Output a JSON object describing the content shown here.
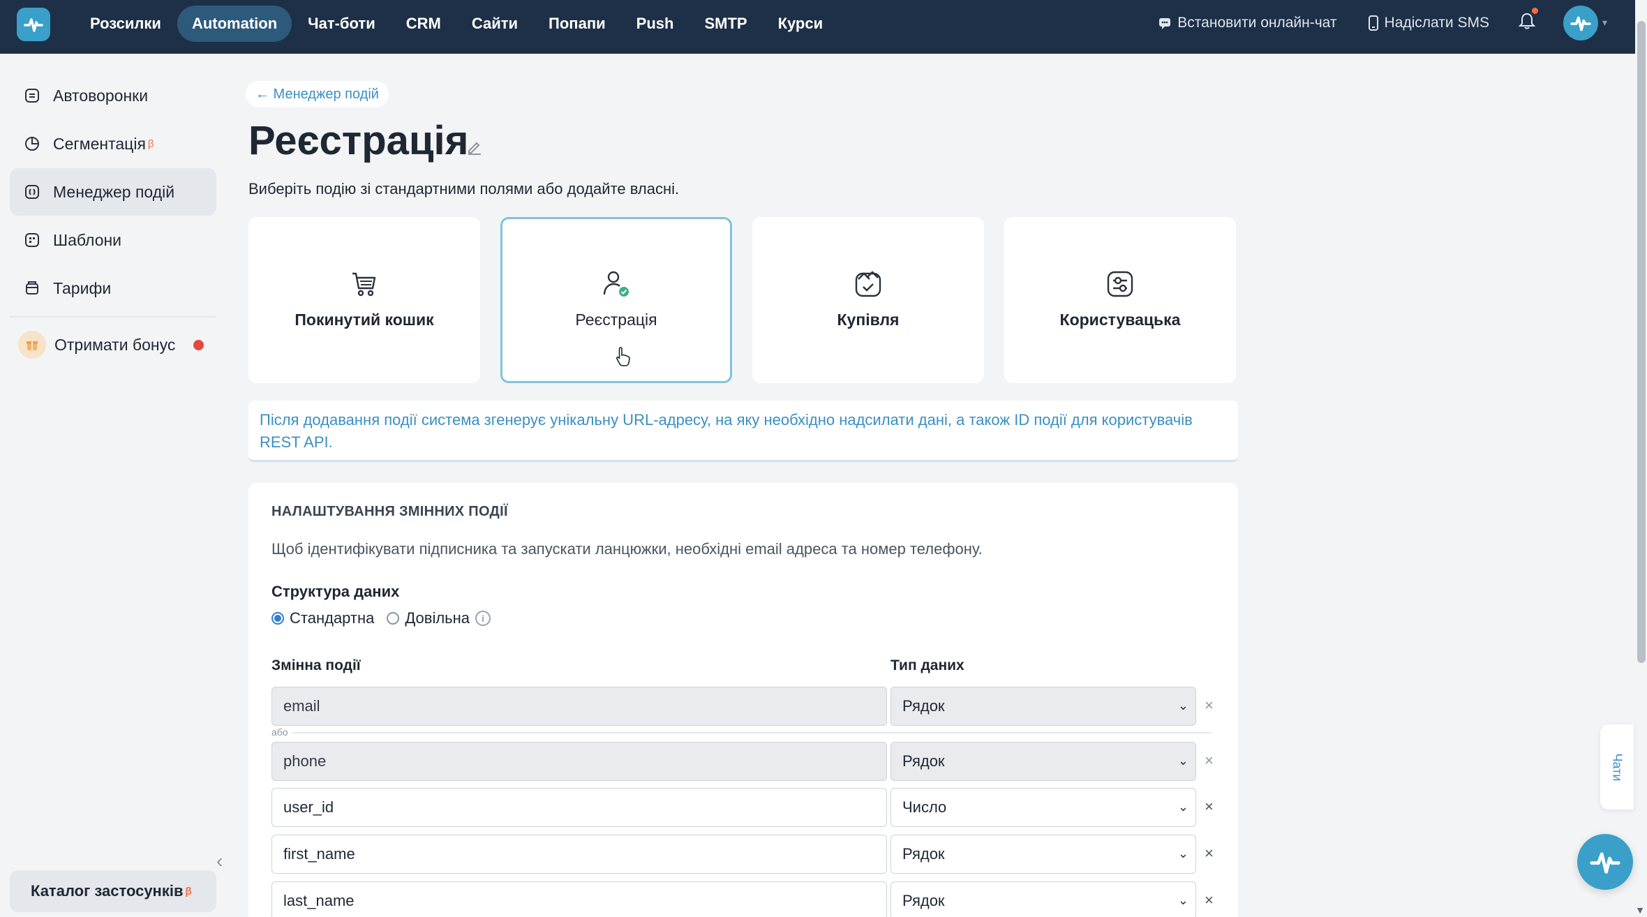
{
  "nav": {
    "items": [
      {
        "label": "Розсилки",
        "active": false
      },
      {
        "label": "Automation",
        "active": true
      },
      {
        "label": "Чат-боти",
        "active": false
      },
      {
        "label": "CRM",
        "active": false
      },
      {
        "label": "Сайти",
        "active": false
      },
      {
        "label": "Попапи",
        "active": false
      },
      {
        "label": "Push",
        "active": false
      },
      {
        "label": "SMTP",
        "active": false
      },
      {
        "label": "Курси",
        "active": false
      }
    ],
    "install_chat": "Встановити онлайн-чат",
    "send_sms": "Надіслати SMS"
  },
  "sidebar": {
    "items": [
      {
        "label": "Автоворонки",
        "icon": "funnel-icon"
      },
      {
        "label": "Сегментація",
        "icon": "segment-icon",
        "beta": "β"
      },
      {
        "label": "Менеджер подій",
        "icon": "events-icon",
        "active": true
      },
      {
        "label": "Шаблони",
        "icon": "templates-icon"
      },
      {
        "label": "Тарифи",
        "icon": "tariffs-icon"
      }
    ],
    "bonus": "Отримати бонус",
    "catalog": "Каталог застосунків",
    "catalog_beta": "β"
  },
  "breadcrumb": "← Менеджер подій",
  "page": {
    "title": "Реєстрація",
    "subtitle": "Виберіть подію зі стандартними полями або додайте власні."
  },
  "cards": [
    {
      "label": "Покинутий кошик",
      "icon": "cart-icon",
      "selected": false
    },
    {
      "label": "Реєстрація",
      "icon": "user-check-icon",
      "selected": true
    },
    {
      "label": "Купівля",
      "icon": "purchase-icon",
      "selected": false
    },
    {
      "label": "Користувацька",
      "icon": "custom-icon",
      "selected": false
    }
  ],
  "info": "Після додавання події система згенерує унікальну URL-адресу, на яку необхідно надсилати дані, а також ID події для користувачів REST API.",
  "settings": {
    "title": "НАЛАШТУВАННЯ ЗМІННИХ ПОДІЇ",
    "description": "Щоб ідентифікувати підписника та запускати ланцюжки, необхідні email адреса та номер телефону.",
    "structure_label": "Структура даних",
    "radio_standard": "Стандартна",
    "radio_custom": "Довільна",
    "col_variable": "Змінна події",
    "col_type": "Тип даних",
    "or_label": "або",
    "rows": [
      {
        "name": "email",
        "type": "Рядок",
        "disabled": true
      },
      {
        "name": "phone",
        "type": "Рядок",
        "disabled": true
      },
      {
        "name": "user_id",
        "type": "Число",
        "disabled": false
      },
      {
        "name": "first_name",
        "type": "Рядок",
        "disabled": false
      },
      {
        "name": "last_name",
        "type": "Рядок",
        "disabled": false
      }
    ]
  },
  "chat_tab": "Чати",
  "colors": {
    "nav_bg": "#1e3047",
    "accent": "#3aa0c9",
    "link": "#3a8fc2",
    "selected_border": "#7ec3df"
  }
}
